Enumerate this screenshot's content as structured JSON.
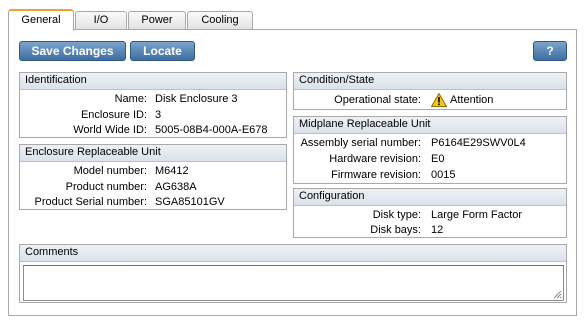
{
  "tabs": [
    {
      "label": "General",
      "active": true
    },
    {
      "label": "I/O",
      "active": false
    },
    {
      "label": "Power",
      "active": false
    },
    {
      "label": "Cooling",
      "active": false
    }
  ],
  "toolbar": {
    "save_label": "Save Changes",
    "locate_label": "Locate",
    "help_label": "?"
  },
  "identification": {
    "title": "Identification",
    "name_label": "Name:",
    "name_value": "Disk Enclosure 3",
    "enclosure_id_label": "Enclosure ID:",
    "enclosure_id_value": "3",
    "wwid_label": "World Wide ID:",
    "wwid_value": "5005-08B4-000A-E678"
  },
  "eru": {
    "title": "Enclosure Replaceable Unit",
    "model_label": "Model number:",
    "model_value": "M6412",
    "product_label": "Product number:",
    "product_value": "AG638A",
    "serial_label": "Product Serial number:",
    "serial_value": "SGA85101GV"
  },
  "condition": {
    "title": "Condition/State",
    "op_state_label": "Operational state:",
    "op_state_value": "Attention",
    "op_state_icon": "warning-icon"
  },
  "midplane": {
    "title": "Midplane Replaceable Unit",
    "assembly_label": "Assembly serial number:",
    "assembly_value": "P6164E29SWV0L4",
    "hw_label": "Hardware revision:",
    "hw_value": "E0",
    "fw_label": "Firmware revision:",
    "fw_value": "0015"
  },
  "configuration": {
    "title": "Configuration",
    "disk_type_label": "Disk type:",
    "disk_type_value": "Large Form Factor",
    "disk_bays_label": "Disk bays:",
    "disk_bays_value": "12"
  },
  "comments": {
    "title": "Comments",
    "value": ""
  },
  "colors": {
    "button": "#4f7fb2",
    "active_tab_accent": "#f0a030",
    "section_header": "#dfe6ee",
    "warning": "#f5c518"
  }
}
